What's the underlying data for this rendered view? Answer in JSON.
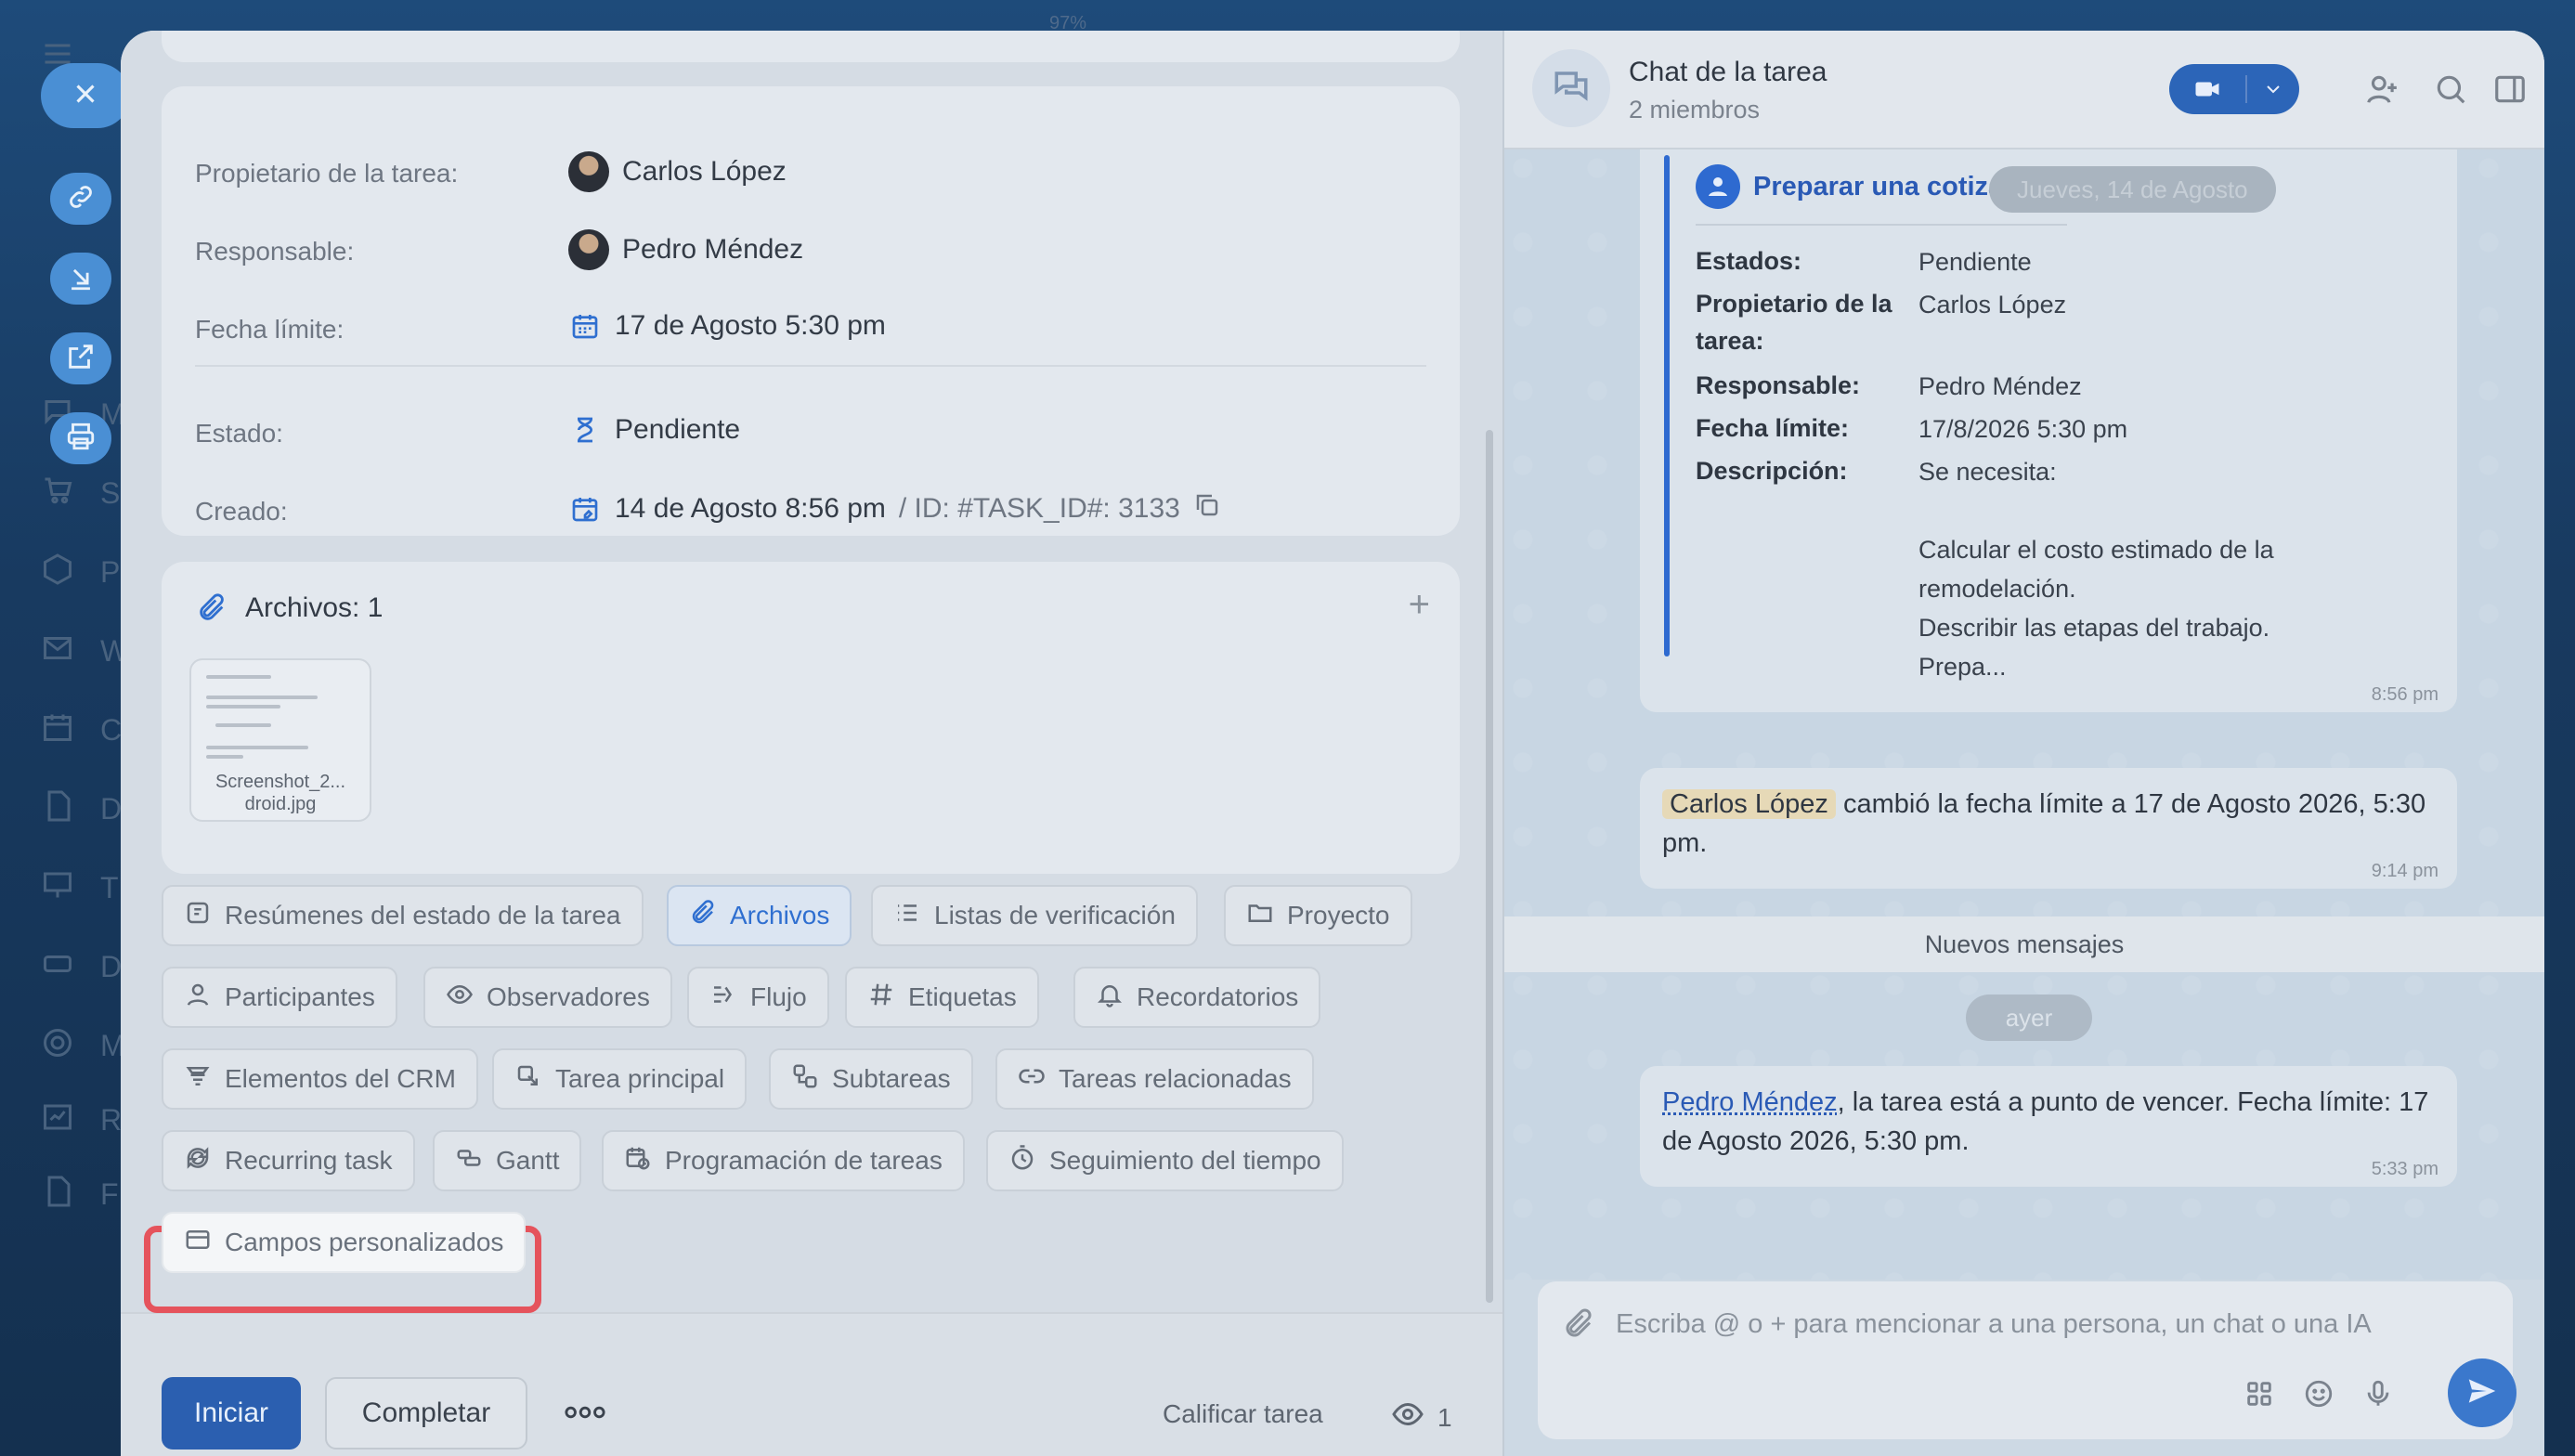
{
  "background": {
    "progress_text": "97%",
    "sidebar_letters": [
      "M",
      "S",
      "P",
      "W",
      "C",
      "D",
      "T",
      "D",
      "M",
      "R",
      "F"
    ]
  },
  "side_actions": {
    "close_icon": "close-icon",
    "link_icon": "link-icon",
    "minimize_icon": "arrow-down-right-icon",
    "open_new_icon": "external-link-icon",
    "print_icon": "printer-icon"
  },
  "task_info": {
    "owner_label": "Propietario de la tarea:",
    "owner_value": "Carlos López",
    "responsible_label": "Responsable:",
    "responsible_value": "Pedro Méndez",
    "deadline_label": "Fecha límite:",
    "deadline_value": "17 de Agosto 5:30 pm",
    "status_label": "Estado:",
    "status_value": "Pendiente",
    "created_label": "Creado:",
    "created_value": "14 de Agosto 8:56 pm",
    "id_text": "/  ID: #TASK_ID#: 3133"
  },
  "files": {
    "title": "Archivos: 1",
    "add_label": "+",
    "file_name_line1": "Screenshot_2...",
    "file_name_line2": "droid.jpg"
  },
  "chips": {
    "row1": [
      "Resúmenes del estado de la tarea",
      "Archivos",
      "Listas de verificación",
      "Proyecto"
    ],
    "row2": [
      "Participantes",
      "Observadores",
      "Flujo",
      "Etiquetas",
      "Recordatorios"
    ],
    "row3": [
      "Elementos del CRM",
      "Tarea principal",
      "Subtareas",
      "Tareas relacionadas"
    ],
    "row4": [
      "Recurring task",
      "Gantt",
      "Programación de tareas",
      "Seguimiento del tiempo"
    ],
    "row5": [
      "Campos personalizados"
    ]
  },
  "bottom_bar": {
    "start_label": "Iniciar",
    "complete_label": "Completar",
    "more_label": "ooo",
    "rate_label": "Calificar tarea",
    "views_count": "1"
  },
  "chat": {
    "title": "Chat de la tarea",
    "subtitle": "2 miembros",
    "task_card": {
      "title": "Preparar una cotización",
      "date_pill": "Jueves, 14 de Agosto",
      "fields": [
        {
          "k": "Estados:",
          "v": "Pendiente"
        },
        {
          "k": "Propietario de la tarea:",
          "v": "Carlos López"
        },
        {
          "k": "Responsable:",
          "v": "Pedro Méndez"
        },
        {
          "k": "Fecha límite:",
          "v": "17/8/2026 5:30 pm"
        },
        {
          "k": "Descripción:",
          "v": "Se necesita:"
        }
      ],
      "description_lines": [
        "Calcular el costo estimado de la",
        "remodelación.",
        "Describir las etapas del trabajo.",
        "Prepa..."
      ],
      "time": "8:56 pm"
    },
    "system_msg": {
      "name": "Carlos López",
      "text": "cambió la fecha límite a 17 de Agosto 2026, 5:30 pm.",
      "time": "9:14 pm"
    },
    "new_messages_label": "Nuevos mensajes",
    "day_label": "ayer",
    "warning_msg": {
      "name": "Pedro Méndez",
      "text": ", la tarea está a punto de vencer. Fecha límite: 17 de Agosto 2026, 5:30 pm.",
      "time": "5:33 pm"
    },
    "composer_placeholder": "Escriba @ o + para mencionar a una persona, un chat o una IA"
  }
}
